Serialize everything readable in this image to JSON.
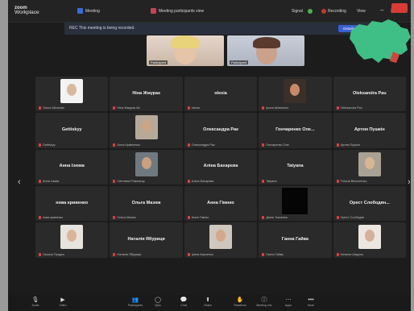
{
  "app": {
    "logo_line1": "zoom",
    "logo_line2": "Workplace"
  },
  "titlebar": {
    "tab_meeting": "Meeting",
    "tab_people": "Meeting participants view",
    "signal_label": "Signal",
    "recording_label": "Recording",
    "view_label": "View",
    "minimize": "–",
    "maximize": "▢",
    "close": "✕"
  },
  "banner": {
    "text": "REC This meeting is being recorded.",
    "button": "Details"
  },
  "strip": [
    {
      "name": "Participant"
    },
    {
      "name": "Participant"
    }
  ],
  "tiles": [
    {
      "type": "photo",
      "name": "",
      "foot": "Ольга Мельник",
      "skin": "#d9b8a0",
      "bg": "#f3f3f3"
    },
    {
      "type": "name",
      "name": "Ніна Жмурак",
      "foot": "Ніна Жмурак 6А"
    },
    {
      "type": "name",
      "name": "olesia",
      "foot": "olesia"
    },
    {
      "type": "photo",
      "name": "",
      "foot": "Ірина Шевченко",
      "skin": "#c98a6a",
      "bg": "#3b2f2a"
    },
    {
      "type": "name",
      "name": "Oleksandra Pau",
      "foot": "Oleksandra Pau"
    },
    {
      "type": "name",
      "name": "Gettiskyy",
      "foot": "Gettiskyy"
    },
    {
      "type": "photo",
      "name": "",
      "foot": "Алла Кравченко",
      "skin": "#caa586",
      "bg": "#b7a99a"
    },
    {
      "type": "name",
      "name": "Олександра Рак",
      "foot": "Олександра Рак"
    },
    {
      "type": "name",
      "name": "Гончаренко Оле...",
      "foot": "Гончаренко Оле"
    },
    {
      "type": "name",
      "name": "Артем Пушкін",
      "foot": "Артем Пушкін"
    },
    {
      "type": "name",
      "name": "Анна Ізюма",
      "foot": "Анна Ізюма"
    },
    {
      "type": "photo",
      "name": "",
      "foot": "Світлана Романець",
      "skin": "#caa07e",
      "bg": "#6f7a80"
    },
    {
      "type": "name",
      "name": "Аліна Бахарєва",
      "foot": "Аліна Бахарєва"
    },
    {
      "type": "name",
      "name": "Tatyana",
      "foot": "Tatyana"
    },
    {
      "type": "photo",
      "name": "",
      "foot": "Тетяна Вінниченко",
      "skin": "#d8b694",
      "bg": "#a9a294"
    },
    {
      "type": "name",
      "name": "нова кривенко",
      "foot": "нова кривенко"
    },
    {
      "type": "name",
      "name": "Ольга Мазюк",
      "foot": "Ольга Мазюк"
    },
    {
      "type": "name",
      "name": "Анна Гімних",
      "foot": "Анна Гімних"
    },
    {
      "type": "black",
      "name": "",
      "foot": "Діана Ткаченко"
    },
    {
      "type": "name",
      "name": "Орест Слободян...",
      "foot": "Орест Слободян"
    },
    {
      "type": "photo",
      "name": "",
      "foot": "Оксана Прядко",
      "skin": "#dbb49a",
      "bg": "#e7e3de"
    },
    {
      "type": "name",
      "name": "Наталія Ябуриця",
      "foot": "Наталія Ябуриця"
    },
    {
      "type": "photo",
      "name": "",
      "foot": "Ірина Карпенко",
      "skin": "#d4a888",
      "bg": "#cfc7bd"
    },
    {
      "type": "name",
      "name": "Ганна Гайва",
      "foot": "Ганна Гайва"
    },
    {
      "type": "photo",
      "name": "",
      "foot": "Наталія Шаруль",
      "skin": "#d6b09a",
      "bg": "#ece6e1"
    }
  ],
  "toolbar": [
    {
      "icon": "🎙",
      "label": "Audio",
      "name": "audio-button"
    },
    {
      "icon": "▶",
      "label": "Video",
      "name": "video-button"
    },
    {
      "icon": "👥",
      "label": "Participants",
      "name": "participants-button"
    },
    {
      "icon": "◯",
      "label": "Q&A",
      "name": "qa-button"
    },
    {
      "icon": "💬",
      "label": "Chat",
      "name": "chat-button"
    },
    {
      "icon": "⬆",
      "label": "Share",
      "name": "share-button"
    },
    {
      "icon": "✋",
      "label": "Reactions",
      "name": "reactions-button"
    },
    {
      "icon": "ⓘ",
      "label": "Meeting Info",
      "name": "meeting-info-button"
    },
    {
      "icon": "⋯",
      "label": "Apps",
      "name": "apps-button"
    },
    {
      "icon": "•••",
      "label": "More",
      "name": "more-button"
    }
  ],
  "colors": {
    "accent": "#3a5fcf",
    "end": "#d93a36",
    "map_fill": "#3fbf86"
  }
}
